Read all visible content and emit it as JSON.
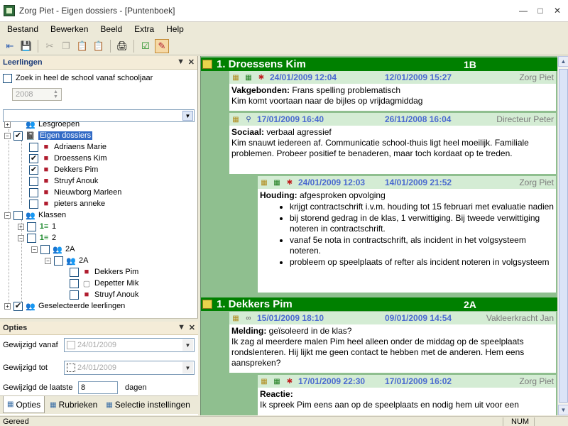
{
  "window": {
    "title": "Zorg Piet - Eigen dossiers - [Puntenboek]"
  },
  "menu": [
    "Bestand",
    "Bewerken",
    "Beeld",
    "Extra",
    "Help"
  ],
  "leerlingen_panel": {
    "title": "Leerlingen",
    "search_school_label": "Zoek in heel de school vanaf schooljaar",
    "year": "2008",
    "tree": {
      "lesgroepen": "Lesgroepen",
      "eigen_dossiers": "Eigen dossiers",
      "eigen_children": [
        "Adriaens Marie",
        "Droessens Kim",
        "Dekkers Pim",
        "Struyf Anouk",
        "Nieuwborg Marleen",
        "pieters anneke"
      ],
      "klassen": "Klassen",
      "k1": "1",
      "k2": "2",
      "k2a": "2A",
      "k2a_sub": "2A",
      "k2a_children": [
        "Dekkers Pim",
        "Depetter Mik",
        "Struyf Anouk"
      ],
      "geselecteerde": "Geselecteerde leerlingen"
    }
  },
  "opties_panel": {
    "title": "Opties",
    "gewijzigd_vanaf_label": "Gewijzigd vanaf",
    "gewijzigd_vanaf_value": "24/01/2009",
    "gewijzigd_tot_label": "Gewijzigd tot",
    "gewijzigd_tot_value": "24/01/2009",
    "laatste_label": "Gewijzigd de laatste",
    "laatste_value": "8",
    "dagen_label": "dagen"
  },
  "tabs": [
    "Opties",
    "Rubrieken",
    "Selectie instellingen"
  ],
  "students": [
    {
      "name": "1. Droessens Kim",
      "klas": "1B",
      "entries": [
        {
          "date1": "24/01/2009 12:04",
          "date2": "12/01/2009 15:27",
          "author": "Zorg Piet",
          "category": "Vakgebonden:",
          "subject": "Frans spelling problematisch",
          "text": "Kim komt voortaan naar de bijles op vrijdagmiddag"
        },
        {
          "date1": "17/01/2009 16:40",
          "date2": "26/11/2008 16:04",
          "author": "Directeur Peter",
          "category": "Sociaal:",
          "subject": "verbaal agressief",
          "text": "Kim snauwt iedereen af. Communicatie school-thuis ligt heel moeilijk. Familiale problemen. Probeer positief te benaderen, maar toch kordaat op te treden."
        },
        {
          "date1": "24/01/2009 12:03",
          "date2": "14/01/2009 21:52",
          "author": "Zorg Piet",
          "category": "Houding:",
          "subject": "afgesproken opvolging",
          "bullets": [
            "krijgt contractschrift i.v.m. houding tot 15 februari met evaluatie nadien",
            "bij storend gedrag in de klas, 1 verwittiging. Bij tweede verwittiging noteren in contractschrift.",
            "vanaf 5e nota in contractschrift, als incident in het volgsysteem noteren.",
            "probleem op speelplaats of refter als incident noteren in volgsysteem"
          ]
        }
      ]
    },
    {
      "name": "1. Dekkers Pim",
      "klas": "2A",
      "entries": [
        {
          "date1": "15/01/2009 18:10",
          "date2": "09/01/2009 14:54",
          "author": "Vakleerkracht Jan",
          "category": "Melding:",
          "subject": "geïsoleerd in de klas?",
          "text": "Ik zag al meerdere malen Pim heel alleen onder de middag op de speelplaats rondslenteren. Hij lijkt me geen contact te hebben met de anderen. Hem eens aanspreken?"
        },
        {
          "date1": "17/01/2009 22:30",
          "date2": "17/01/2009 16:02",
          "author": "Zorg Piet",
          "category": "Reactie:",
          "subject": "",
          "text": "Ik spreek Pim eens aan op de speelplaats en nodig hem uit voor een"
        }
      ]
    }
  ],
  "status": {
    "text": "Gereed",
    "num": "NUM"
  },
  "colors": {
    "accent_green": "#008000",
    "panel_bg": "#8fbf8f",
    "selection": "#316ac5"
  }
}
